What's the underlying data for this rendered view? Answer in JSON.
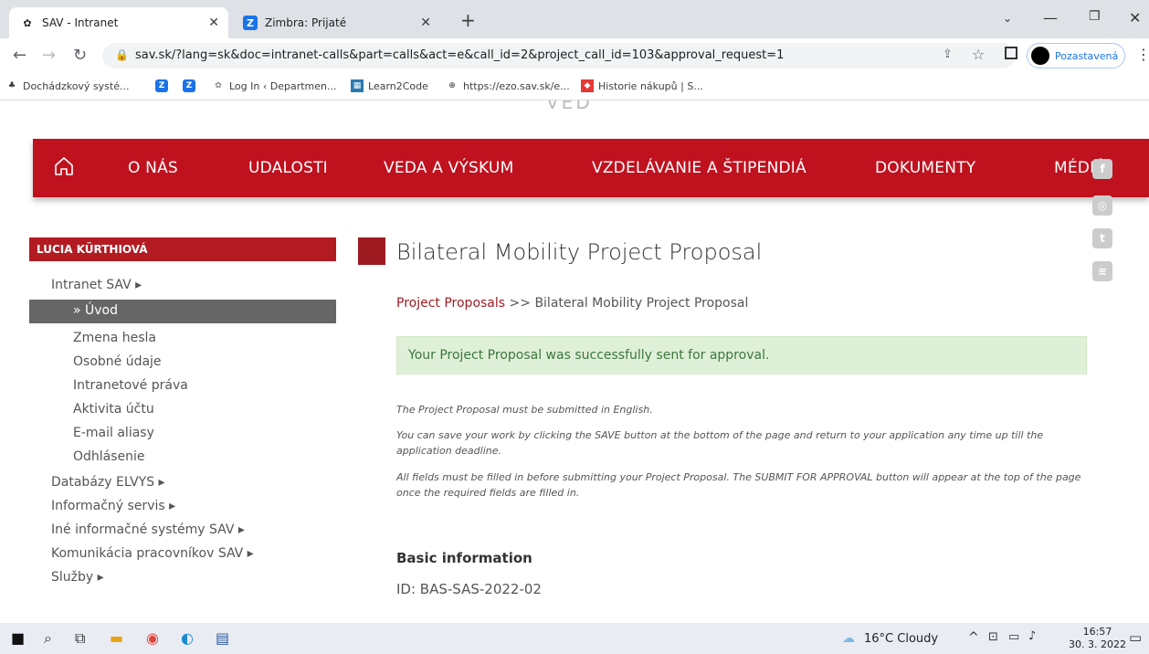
{
  "browser": {
    "tabs": [
      {
        "title": "SAV - Intranet",
        "active": true
      },
      {
        "title": "Zimbra: Prijaté",
        "active": false
      }
    ],
    "new_tab": "+",
    "url": "sav.sk/?lang=sk&doc=intranet-calls&part=calls&act=e&call_id=2&project_call_id=103&approval_request=1",
    "profile": "Pozastavená",
    "bookmarks": [
      {
        "label": "Dochádzkový systé..."
      },
      {
        "label": ""
      },
      {
        "label": ""
      },
      {
        "label": "Log In ‹ Departmen..."
      },
      {
        "label": "Learn2Code"
      },
      {
        "label": "https://ezo.sav.sk/e..."
      },
      {
        "label": "Historie nákupů | S..."
      }
    ]
  },
  "site": {
    "nav": [
      "O NÁS",
      "UDALOSTI",
      "VEDA A VÝSKUM",
      "VZDELÁVANIE A ŠTIPENDIÁ",
      "DOKUMENTY",
      "MÉDIÁ"
    ],
    "header_partial": "VED",
    "sidebar": {
      "user": "LUCIA KÜRTHIOVÁ",
      "intranet": "Intranet SAV ▸",
      "active": "» Úvod",
      "sub_items": [
        "Zmena hesla",
        "Osobné údaje",
        "Intranetové práva",
        "Aktivita účtu",
        "E-mail aliasy",
        "Odhlásenie"
      ],
      "items": [
        "Databázy ELVYS ▸",
        "Informačný servis ▸",
        "Iné informačné systémy SAV ▸",
        "Komunikácia pracovníkov SAV ▸",
        "Služby ▸"
      ]
    },
    "main": {
      "title": "Bilateral Mobility Project Proposal",
      "breadcrumb_link": "Project Proposals",
      "breadcrumb_rest": " >> Bilateral Mobility Project Proposal",
      "alert": "Your Project Proposal was successfully sent for approval.",
      "notes": [
        "The Project Proposal must be submitted in English.",
        "You can save your work by clicking the SAVE button at the bottom of the page and return to your application any time up till the application deadline.",
        "All fields must be filled in before submitting your Project Proposal. The SUBMIT FOR APPROVAL button will appear at the top of the page once the required fields are filled in."
      ],
      "section_title": "Basic information",
      "id_line": "ID: BAS-SAS-2022-02"
    }
  },
  "taskbar": {
    "weather": "16°C  Cloudy",
    "time": "16:57",
    "date": "30. 3. 2022"
  }
}
